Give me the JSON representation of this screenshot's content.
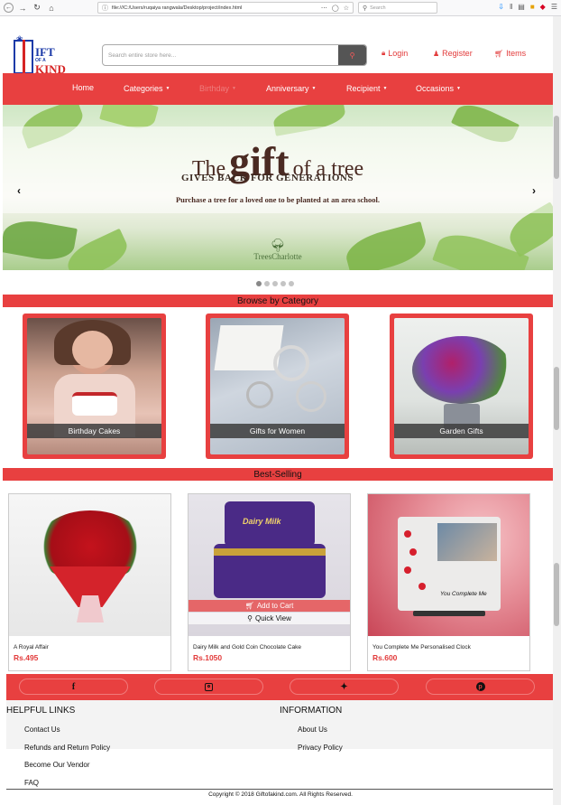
{
  "browser": {
    "url": "file:///C:/Users/ruqaiya rangwala/Desktop/project/index.html",
    "search_placeholder": "Search"
  },
  "header": {
    "logo": {
      "line1": "IFT",
      "line2": "OF A",
      "line3": "KIND"
    },
    "search_placeholder": "Search entire store here...",
    "login": "Login",
    "register": "Register",
    "items": "Items"
  },
  "nav": {
    "items": [
      {
        "label": "Home"
      },
      {
        "label": "Categories"
      },
      {
        "label": "Birthday"
      },
      {
        "label": "Anniversary"
      },
      {
        "label": "Recipient"
      },
      {
        "label": "Occasions"
      }
    ]
  },
  "hero": {
    "line1_prefix": "The",
    "line1_big": "gift",
    "line1_suffix": "of a tree",
    "subtitle": "GIVES BACK FOR GENERATIONS",
    "description": "Purchase a tree for a loved one to be planted at an area school.",
    "brand": "TreesCharlotte",
    "slide_count": 5,
    "active_slide": 1
  },
  "browse": {
    "title": "Browse by Category",
    "categories": [
      {
        "label": "Birthday Cakes"
      },
      {
        "label": "Gifts for Women"
      },
      {
        "label": "Garden Gifts"
      }
    ]
  },
  "bestselling": {
    "title": "Best-Selling",
    "products": [
      {
        "name": "A Royal Affair",
        "price": "Rs.495"
      },
      {
        "name": "Dairy Milk and Gold Coin Chocolate Cake",
        "price": "Rs.1050"
      },
      {
        "name": "You Complete Me Personalised Clock",
        "price": "Rs.600"
      }
    ],
    "add_to_cart": "Add to Cart",
    "quick_view": "Quick View",
    "clock_text": "You Complete Me",
    "chocolate_brand": "Dairy Milk"
  },
  "social": {
    "icons": [
      "facebook-icon",
      "instagram-icon",
      "twitter-icon",
      "pinterest-icon"
    ]
  },
  "footer": {
    "helpful_title": "HELPFUL LINKS",
    "helpful_links": [
      {
        "label": "Contact Us"
      },
      {
        "label": "Refunds and Return Policy"
      },
      {
        "label": "Become Our Vendor"
      },
      {
        "label": "FAQ"
      }
    ],
    "info_title": "INFORMATION",
    "info_links": [
      {
        "label": "About Us"
      },
      {
        "label": "Privacy Policy"
      }
    ],
    "copyright": "Copyright © 2018 Giftofakind.com. All Rights Reserved."
  },
  "colors": {
    "accent": "#e84040",
    "link_red": "#e23b3b",
    "logo_blue": "#1b3aa8"
  }
}
